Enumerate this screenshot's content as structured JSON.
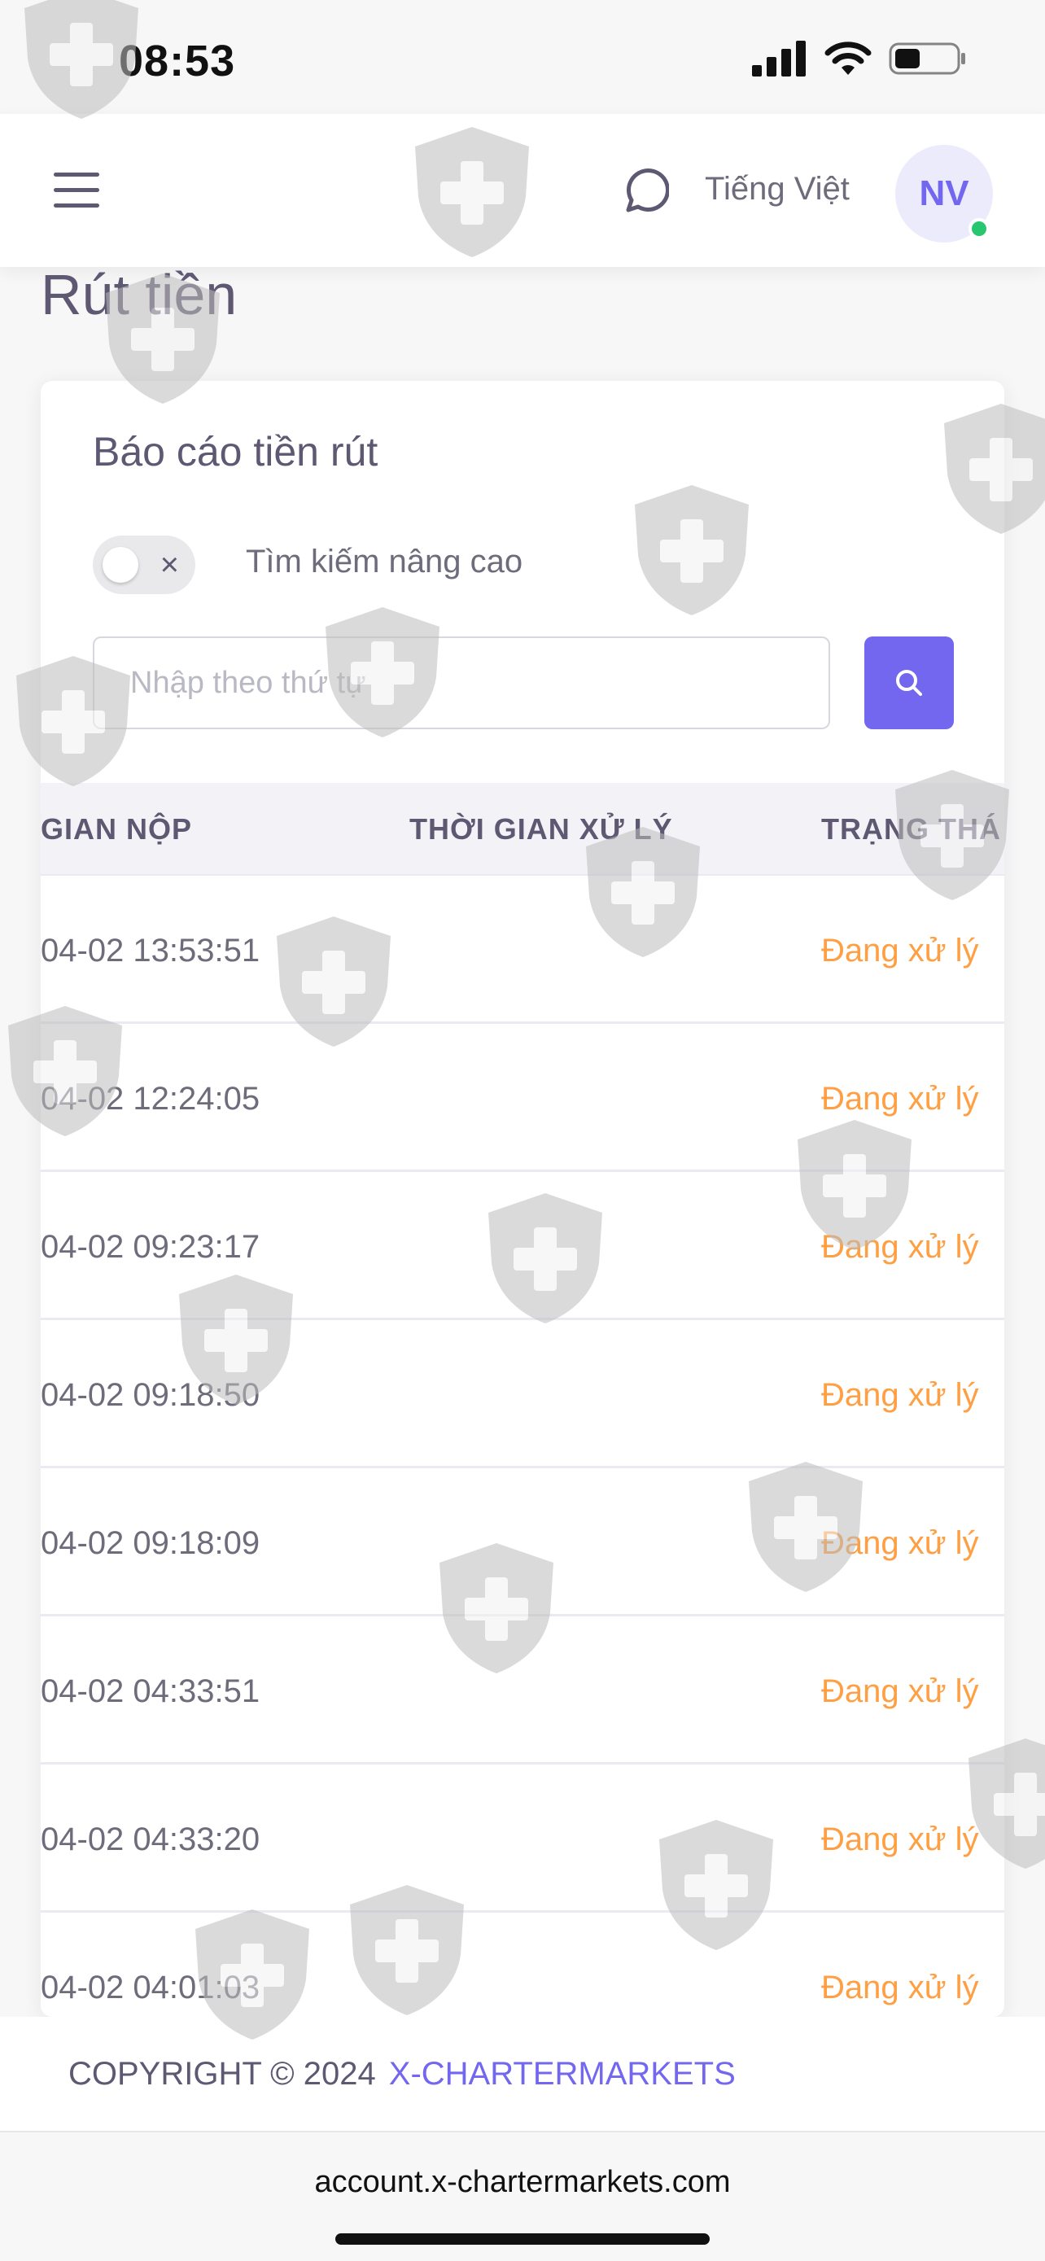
{
  "status_bar": {
    "time": "08:53"
  },
  "header": {
    "language": "Tiếng Việt",
    "avatar_initials": "NV"
  },
  "page": {
    "title": "Rút tiền"
  },
  "report": {
    "title": "Báo cáo tiền rút",
    "advanced_search_label": "Tìm kiếm nâng cao",
    "advanced_search_enabled": false,
    "search_placeholder": "Nhập theo thứ tự",
    "columns": [
      "GIAN NỘP",
      "THỜI GIAN XỬ LÝ",
      "TRẠNG THÁ"
    ],
    "rows": [
      {
        "submitted": "04-02 13:53:51",
        "processed": "",
        "status": "Đang xử lý"
      },
      {
        "submitted": "04-02 12:24:05",
        "processed": "",
        "status": "Đang xử lý"
      },
      {
        "submitted": "04-02 09:23:17",
        "processed": "",
        "status": "Đang xử lý"
      },
      {
        "submitted": "04-02 09:18:50",
        "processed": "",
        "status": "Đang xử lý"
      },
      {
        "submitted": "04-02 09:18:09",
        "processed": "",
        "status": "Đang xử lý"
      },
      {
        "submitted": "04-02 04:33:51",
        "processed": "",
        "status": "Đang xử lý"
      },
      {
        "submitted": "04-02 04:33:20",
        "processed": "",
        "status": "Đang xử lý"
      },
      {
        "submitted": "04-02 04:01:03",
        "processed": "",
        "status": "Đang xử lý"
      }
    ]
  },
  "footer": {
    "copyright": "COPYRIGHT © 2024",
    "brand": "X-CHARTERMARKETS"
  },
  "browser": {
    "url": "account.x-chartermarkets.com"
  },
  "colors": {
    "primary": "#7367f0",
    "status_processing": "#ff9f43",
    "online": "#28c76f"
  },
  "icons": [
    "hamburger-menu-icon",
    "chat-bubble-icon",
    "search-icon",
    "signal-icon",
    "wifi-icon",
    "battery-icon",
    "shield-watermark-icon"
  ]
}
